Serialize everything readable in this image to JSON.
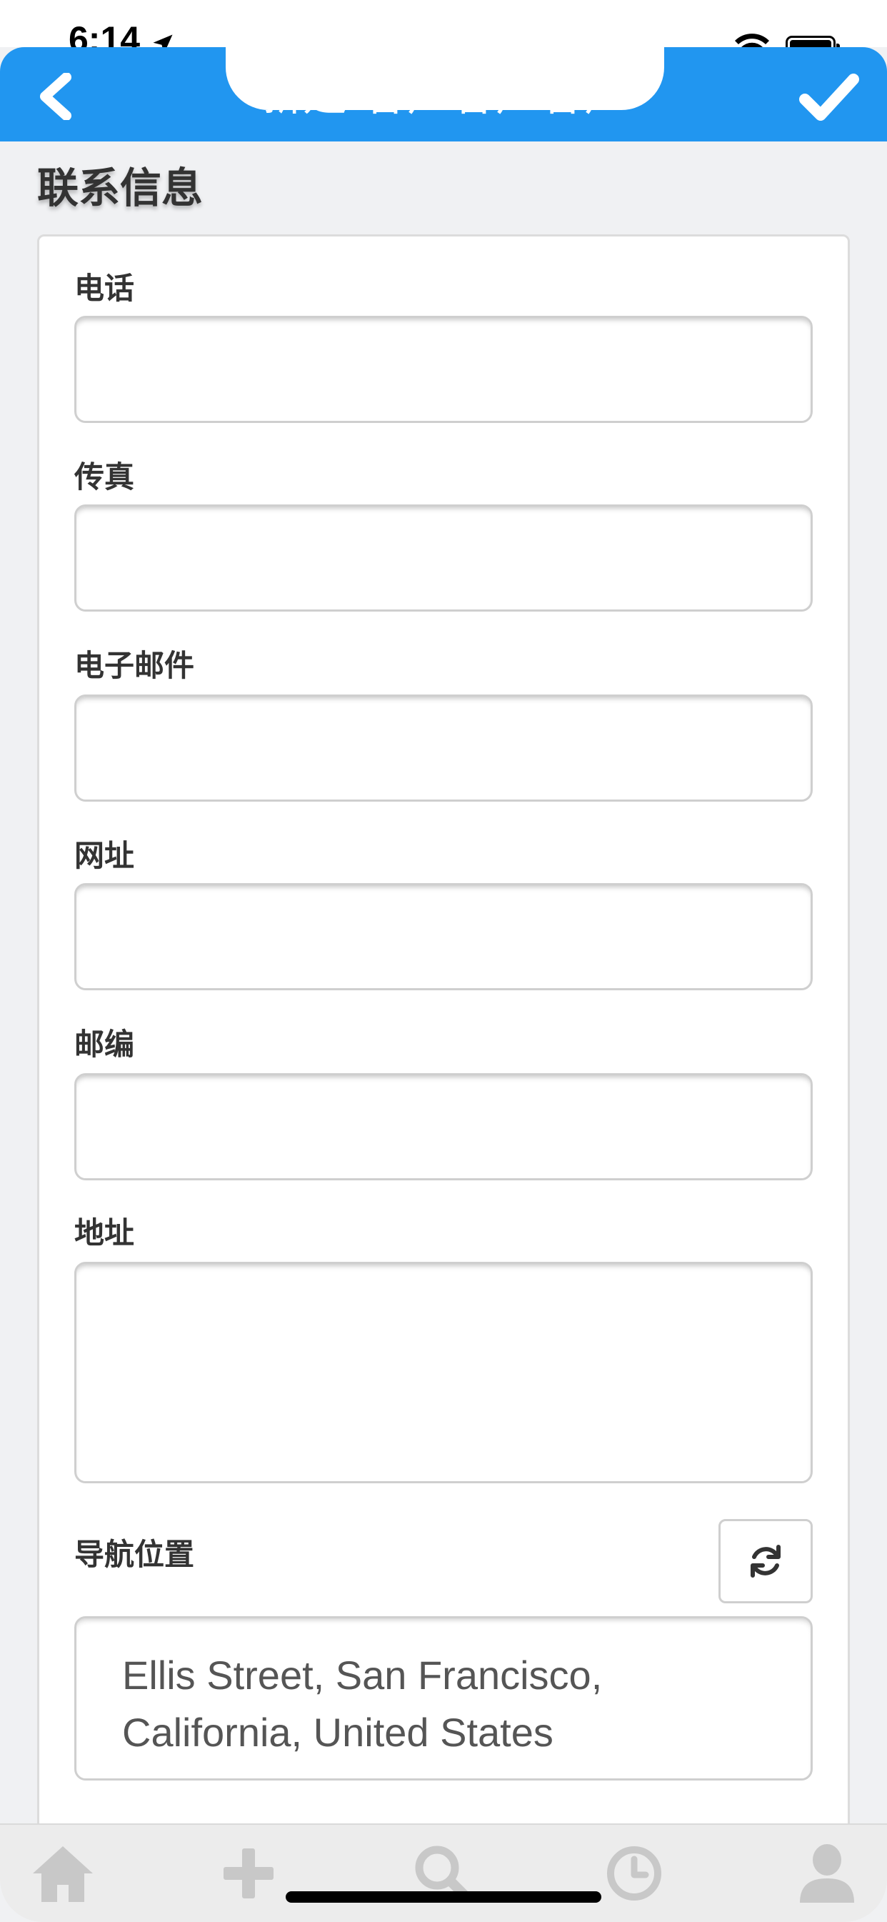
{
  "status_bar": {
    "time": "6:14"
  },
  "header": {
    "title": "新建-客户客户客户"
  },
  "section": {
    "title": "联系信息"
  },
  "fields": {
    "phone": {
      "label": "电话",
      "value": ""
    },
    "fax": {
      "label": "传真",
      "value": ""
    },
    "email": {
      "label": "电子邮件",
      "value": ""
    },
    "website": {
      "label": "网址",
      "value": ""
    },
    "postcode": {
      "label": "邮编",
      "value": ""
    },
    "address": {
      "label": "地址",
      "value": ""
    },
    "nav_location": {
      "label": "导航位置",
      "value": "Ellis Street, San Francisco, California, United States"
    }
  },
  "tab_bar": {
    "items": [
      {
        "icon": "home-icon"
      },
      {
        "icon": "plus-icon"
      },
      {
        "icon": "search-icon"
      },
      {
        "icon": "clock-icon"
      },
      {
        "icon": "user-icon"
      }
    ]
  },
  "colors": {
    "accent": "#2196f0",
    "tab_icon": "#c8c8c8"
  }
}
